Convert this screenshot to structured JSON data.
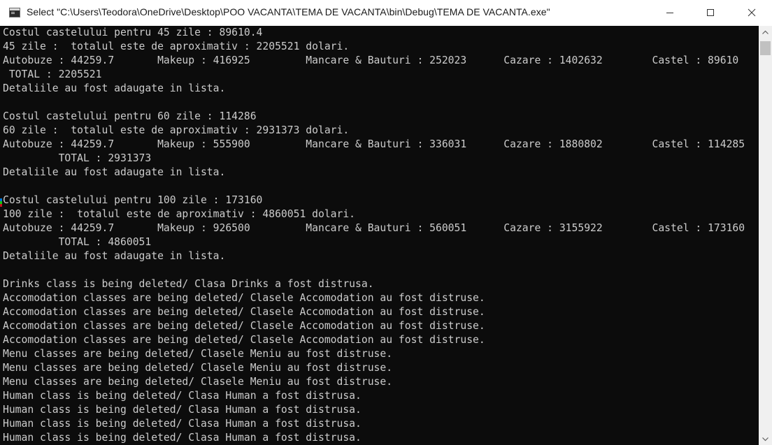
{
  "window": {
    "title": "Select \"C:\\Users\\Teodora\\OneDrive\\Desktop\\POO VACANTA\\TEMA DE VACANTA\\bin\\Debug\\TEMA DE VACANTA.exe\"",
    "icon": "console-app-icon",
    "controls": [
      "minimize-icon",
      "maximize-icon",
      "close-icon"
    ]
  },
  "console": {
    "lines": [
      "Costul castelului pentru 45 zile : 89610.4",
      "45 zile :  totalul este de aproximativ : 2205521 dolari.",
      "Autobuze : 44259.7       Makeup : 416925         Mancare & Bauturi : 252023      Cazare : 1402632        Castel : 89610",
      " TOTAL : 2205521",
      "Detaliile au fost adaugate in lista.",
      "",
      "Costul castelului pentru 60 zile : 114286",
      "60 zile :  totalul este de aproximativ : 2931373 dolari.",
      "Autobuze : 44259.7       Makeup : 555900         Mancare & Bauturi : 336031      Cazare : 1880802        Castel : 114285",
      "         TOTAL : 2931373",
      "Detaliile au fost adaugate in lista.",
      "",
      "Costul castelului pentru 100 zile : 173160",
      "100 zile :  totalul este de aproximativ : 4860051 dolari.",
      "Autobuze : 44259.7       Makeup : 926500         Mancare & Bauturi : 560051      Cazare : 3155922        Castel : 173160",
      "         TOTAL : 4860051",
      "Detaliile au fost adaugate in lista.",
      "",
      "Drinks class is being deleted/ Clasa Drinks a fost distrusa.",
      "Accomodation classes are being deleted/ Clasele Accomodation au fost distruse.",
      "Accomodation classes are being deleted/ Clasele Accomodation au fost distruse.",
      "Accomodation classes are being deleted/ Clasele Accomodation au fost distruse.",
      "Accomodation classes are being deleted/ Clasele Accomodation au fost distruse.",
      "Menu classes are being deleted/ Clasele Meniu au fost distruse.",
      "Menu classes are being deleted/ Clasele Meniu au fost distruse.",
      "Menu classes are being deleted/ Clasele Meniu au fost distruse.",
      "Human class is being deleted/ Clasa Human a fost distrusa.",
      "Human class is being deleted/ Clasa Human a fost distrusa.",
      "Human class is being deleted/ Clasa Human a fost distrusa.",
      "Human class is being deleted/ Clasa Human a fost distrusa."
    ]
  },
  "colors": {
    "console_background": "#0c0c0c",
    "console_text": "#cccccc",
    "titlebar_background": "#ffffff",
    "scrollbar_track": "#f0f0f0",
    "scrollbar_thumb": "#c1c1c1",
    "left_marks": [
      "#0078d7",
      "#16c60c",
      "#c50f1f"
    ]
  },
  "scrollbar": {
    "position_fraction": 0.0
  }
}
